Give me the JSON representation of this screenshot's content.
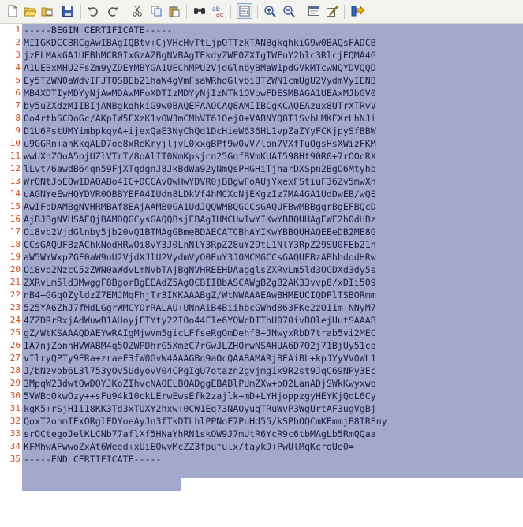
{
  "toolbar": {
    "icons": [
      "new-file-icon",
      "open-folder-icon",
      "open-recent-icon",
      "save-icon",
      "undo-icon",
      "redo-icon",
      "cut-icon",
      "copy-icon",
      "paste-icon",
      "find-icon",
      "replace-icon",
      "word-wrap-icon",
      "zoom-in-icon",
      "zoom-out-icon",
      "view-icon",
      "edit-mode-icon",
      "run-icon"
    ]
  },
  "colors": {
    "selection": "#a3a9ca",
    "line_number": "#d84a1b",
    "text": "#1a1c4a"
  },
  "editor": {
    "lines": [
      {
        "n": "1",
        "text": "-----BEGIN CERTIFICATE-----"
      },
      {
        "n": "2",
        "text": "MIIGKDCCBRCgAwIBAgIQBtv+CjVHcHvTtLjpOTTzkTANBgkqhkiG9w0BAQsFADCB"
      },
      {
        "n": "3",
        "text": "jzELMAkGA1UEBhMCR0IxGzAZBgNVBAgTEkdyZWF0ZXIgTWFuY2hlc3RlcjEQMA4G"
      },
      {
        "n": "4",
        "text": "A1UEBxMHU2FsZm9yZDEYMBYGA1UEChMPU2VjdGlnbyBMaW1pdGVkMTcwNQYDVQQD"
      },
      {
        "n": "5",
        "text": "Ey5TZWN0aWdvIFJTQSBEb21haW4gVmFsaWRhdGlvbiBTZWN1cmUgU2VydmVyIENB"
      },
      {
        "n": "6",
        "text": "MB4XDTIyMDYyNjAwMDAwMFoXDTIzMDYyNjIzNTk1OVowFDESMBAGA1UEAxMJbGV0"
      },
      {
        "n": "7",
        "text": "by5uZXdzMIIBIjANBgkqhkiG9w0BAQEFAAOCAQ8AMIIBCgKCAQEAzux8UTrXTRvV"
      },
      {
        "n": "8",
        "text": "Oo4rtbSCDoGc/AKpIW5FXzK1vOW3mCMbVT61Oej0+VABNYQ8T1SvbLMKEXrLhNJi"
      },
      {
        "n": "9",
        "text": "D1U6PstUMYimbpkqyA+ijexQaE3NyChQd1DcHieW636HL1vpZaZYyFCKjpySfBBW"
      },
      {
        "n": "10",
        "text": "u9GGRn+anKkqALD7oe8xReKryjljvL0xxgBPf9w0vV/lon7VXfTuOgsHsXWizFKM"
      },
      {
        "n": "11",
        "text": "wwUXhZOoA5pjUZlVTrT/8oAlIT0NmKpsjcn25GqfBVmKUAI598Ht90R0+7rOOcRX"
      },
      {
        "n": "12",
        "text": "lLvt/6awdB64qn59FjXTqdgnJ8JkBdWa92yNmQsPHGHiTjharDXSpn2BgO6Mtyhb"
      },
      {
        "n": "13",
        "text": "WrQNtJoEQwIDAQABo4IC+DCCAvQwHwYDVR0jBBgwFoAUjYxexFStiuF36Zv5mwXh"
      },
      {
        "n": "14",
        "text": "uAGNYeEwHQYDVR0OBBYEFA4IUdn8LDkVf4hMCXcNjEKgzIz7MA4GA1UdDwEB/wQE"
      },
      {
        "n": "15",
        "text": "AwIFoDAMBgNVHRMBAf8EAjAAMB0GA1UdJQQWMBQGCCsGAQUFBwMBBggrBgEFBQcD"
      },
      {
        "n": "16",
        "text": "AjBJBgNVHSAEQjBAMDQGCysGAQQBsjEBAgIHMCUwIwYIKwYBBQUHAgEWF2h0dHBz"
      },
      {
        "n": "17",
        "text": "Oi8vc2VjdGlnby5jb20vQ1BTMAgGBmeBDAECATCBhAYIKwYBBQUHAQEEeDB2ME8G"
      },
      {
        "n": "18",
        "text": "CCsGAQUFBzAChkNodHRwOi8vY3J0LnNlY3RpZ28uY29tL1NlY3RpZ29SU0FEb21h"
      },
      {
        "n": "19",
        "text": "aW5WYWxpZGF0aW9uU2VjdXJlU2VydmVyQ0EuY3J0MCMGCCsGAQUFBzABhhdodHRw"
      },
      {
        "n": "20",
        "text": "Oi8vb2NzcC5zZWN0aWdvLmNvbTAjBgNVHREEHDAagglsZXRvLm5ld3OCDXd3dy5s"
      },
      {
        "n": "21",
        "text": "ZXRvLm5ld3MwggF8BgorBgEEAdZ5AgQCBIIBbASCAWgBZgB2AK33vvp8/xDIi509"
      },
      {
        "n": "22",
        "text": "nB4+GGq0ZyldzZ7EMJMqFhjTr3IKKAAABgZ/WtNWAAAEAwBHMEUCIQDPlTSBORmm"
      },
      {
        "n": "23",
        "text": "525YA6ZhJ7fMdLGgrWMCYOrRALAU+UNnAiB4BiihbcGWhd863FKe2zO11m+NNyM7"
      },
      {
        "n": "24",
        "text": "4ZZDRrRxjAdWuwB1AHoyjFTYty22IOo44FIe6YQWcDIThU070ivBOlejUutSAAAB"
      },
      {
        "n": "25",
        "text": "gZ/WtKSAAAQDAEYwRAIgMjwVm5gicLFfseRgOmDehfB+JNwyxRbD7trab5vi2MEC"
      },
      {
        "n": "26",
        "text": "IA7njZpnnHVWABM4q5OZWPDhrG5XmzC7rGwJLZHQrwNSAHUA6D7Q2j71BjUy51co"
      },
      {
        "n": "27",
        "text": "vIlryQPTy9ERa+zraeF3fW0GvW4AAAGBn9aOcQAABAMARjBEAiBL+kpJYyVV0WL1"
      },
      {
        "n": "28",
        "text": "J/bNzvob6L3l753yOv5UdyovV04CPgIgU7otazn2gvjmg1x9R2st9JqC69NPy3Ec"
      },
      {
        "n": "29",
        "text": "3MpqW23dwtQwDQYJKoZIhvcNAQELBQADggEBABlPUmZXw+oQ2LanADjSWkKwyxwo"
      },
      {
        "n": "30",
        "text": "5VWBbOkwOzy++sFu94k10ckLErwEwsEfk2zajlk+mD+LYHjoppzgyHEYKjQoL6Cy"
      },
      {
        "n": "31",
        "text": "kgK5+rSjHIi18KK3Td3xTUXY2hxw+0CW1Eq73NAOyuqTRuWvP3WgUrtAF3ugVgBj"
      },
      {
        "n": "32",
        "text": "QoxT2ohmIExORglFDYoeAyJn3fTkDTLhlPPNoF7PuHd55/kSPhOQCmKEmmjB8IREny"
      },
      {
        "n": "33",
        "text": "srOCtegoJelKLCNb77aflXf5HNaYhRN1skOW9J7mUtR6YcR9c6tbMAgLb5RmQQaa"
      },
      {
        "n": "34",
        "text": "KFMhwAFwwoZxAt6Weed+xUiEOwvMcZZ3fpufulx/taykD+PwUlMqKcroUe0="
      },
      {
        "n": "35",
        "text": "-----END CERTIFICATE-----"
      }
    ]
  }
}
